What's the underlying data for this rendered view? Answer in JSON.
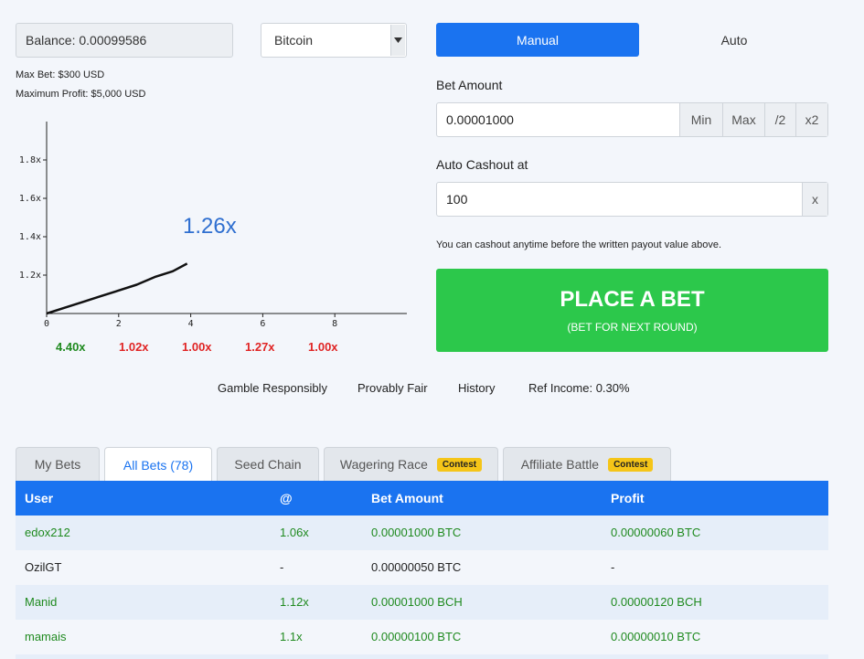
{
  "balance": "Balance: 0.00099586",
  "currency": {
    "selected": "Bitcoin"
  },
  "limits": {
    "max_bet": "Max Bet: $300 USD",
    "max_profit": "Maximum Profit: $5,000 USD"
  },
  "chart_data": {
    "type": "line",
    "x_ticks": [
      "0",
      "2",
      "4",
      "6",
      "8"
    ],
    "y_ticks": [
      "1.2x",
      "1.4x",
      "1.6x",
      "1.8x"
    ],
    "xlim": [
      0,
      10
    ],
    "ylim": [
      1.0,
      2.0
    ],
    "series": [
      {
        "x": [
          0,
          0.5,
          1,
          1.5,
          2,
          2.5,
          3,
          3.5,
          3.9
        ],
        "values": [
          1.0,
          1.03,
          1.06,
          1.09,
          1.12,
          1.15,
          1.19,
          1.22,
          1.26
        ]
      }
    ],
    "current_multiplier": "1.26x"
  },
  "history": [
    {
      "value": "4.40x",
      "color": "#1f8a1f"
    },
    {
      "value": "1.02x",
      "color": "#e02424"
    },
    {
      "value": "1.00x",
      "color": "#e02424"
    },
    {
      "value": "1.27x",
      "color": "#e02424"
    },
    {
      "value": "1.00x",
      "color": "#e02424"
    }
  ],
  "mode_tabs": {
    "manual": "Manual",
    "auto": "Auto"
  },
  "bet_amount": {
    "label": "Bet Amount",
    "value": "0.00001000",
    "min": "Min",
    "max": "Max",
    "half": "/2",
    "double": "x2"
  },
  "auto_cashout": {
    "label": "Auto Cashout at",
    "value": "100",
    "suffix": "x"
  },
  "hint": "You can cashout anytime before the written payout value above.",
  "place_bet": {
    "label": "PLACE A BET",
    "sub": "(BET FOR NEXT ROUND)"
  },
  "footer_links": [
    "Gamble Responsibly",
    "Provably Fair",
    "History",
    "Ref Income: 0.30%"
  ],
  "tabs": [
    {
      "label": "My Bets"
    },
    {
      "label": "All Bets (78)"
    },
    {
      "label": "Seed Chain"
    },
    {
      "label": "Wagering Race",
      "badge": "Contest"
    },
    {
      "label": "Affiliate Battle",
      "badge": "Contest"
    }
  ],
  "table": {
    "headers": [
      "User",
      "@",
      "Bet Amount",
      "Profit"
    ],
    "rows": [
      [
        "edox212",
        "1.06x",
        "0.00001000 BTC",
        "0.00000060 BTC"
      ],
      [
        "OzilGT",
        "-",
        "0.00000050 BTC",
        "-"
      ],
      [
        "Manid",
        "1.12x",
        "0.00001000 BCH",
        "0.00000120 BCH"
      ],
      [
        "mamais",
        "1.1x",
        "0.00000100 BTC",
        "0.00000010 BTC"
      ]
    ]
  },
  "colors": {
    "accent": "#1a73f0",
    "success": "#2cc84b",
    "loss": "#e02424",
    "win": "#1f8a1f"
  }
}
